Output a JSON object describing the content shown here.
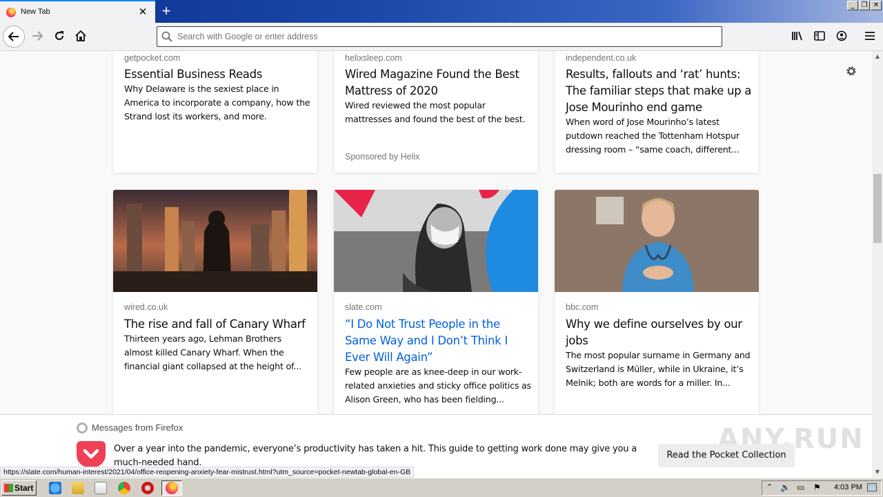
{
  "browser": {
    "tab_title": "New Tab",
    "tab_close": "✕",
    "new_tab": "+",
    "window_controls": {
      "minimize": "_",
      "restore": "❐",
      "close": "✕"
    },
    "url_placeholder": "Search with Google or enter address",
    "accent_color": "#0a84ff"
  },
  "stories": {
    "row1": [
      {
        "source": "getpocket.com",
        "title": "Essential Business Reads",
        "excerpt": "Why Delaware is the sexiest place in America to incorporate a company, how the Strand lost its workers, and more.",
        "sponsor": ""
      },
      {
        "source": "helixsleep.com",
        "title": "Wired Magazine Found the Best Mattress of 2020",
        "excerpt": "Wired reviewed the most popular mattresses and found the best of the best.",
        "sponsor": "Sponsored by Helix"
      },
      {
        "source": "independent.co.uk",
        "title": "Results, fallouts and ‘rat’ hunts: The familiar steps that make up a Jose Mourinho end game",
        "excerpt": "When word of Jose Mourinho’s latest putdown reached the Tottenham Hotspur dressing room – “same coach, different...",
        "sponsor": ""
      }
    ],
    "row2": [
      {
        "source": "wired.co.uk",
        "title": "The rise and fall of Canary Wharf",
        "excerpt": "Thirteen years ago, Lehman Brothers almost killed Canary Wharf. When the financial giant collapsed at the height of..."
      },
      {
        "source": "slate.com",
        "title": "“I Do Not Trust People in the Same Way and I Don’t Think I Ever Will Again”",
        "excerpt": "Few people are as knee-deep in our work-related anxieties and sticky office politics as Alison Green, who has been fielding..."
      },
      {
        "source": "bbc.com",
        "title": "Why we define ourselves by our jobs",
        "excerpt": "The most popular surname in Germany and Switzerland is Müller, while in Ukraine, it’s Melnik; both are words for a miller. In..."
      }
    ]
  },
  "message": {
    "heading": "Messages from Firefox",
    "body": "Over a year into the pandemic, everyone’s productivity has taken a hit. This guide to getting work done may give you a much-needed hand.",
    "button": "Read the Pocket Collection",
    "watermark": "ANY.RUN"
  },
  "status_url": "https://slate.com/human-interest/2021/04/office-reopening-anxiety-fear-mistrust.html?utm_source=pocket-newtab-global-en-GB",
  "taskbar": {
    "start_label": "Start",
    "clock": "4:03 PM"
  }
}
